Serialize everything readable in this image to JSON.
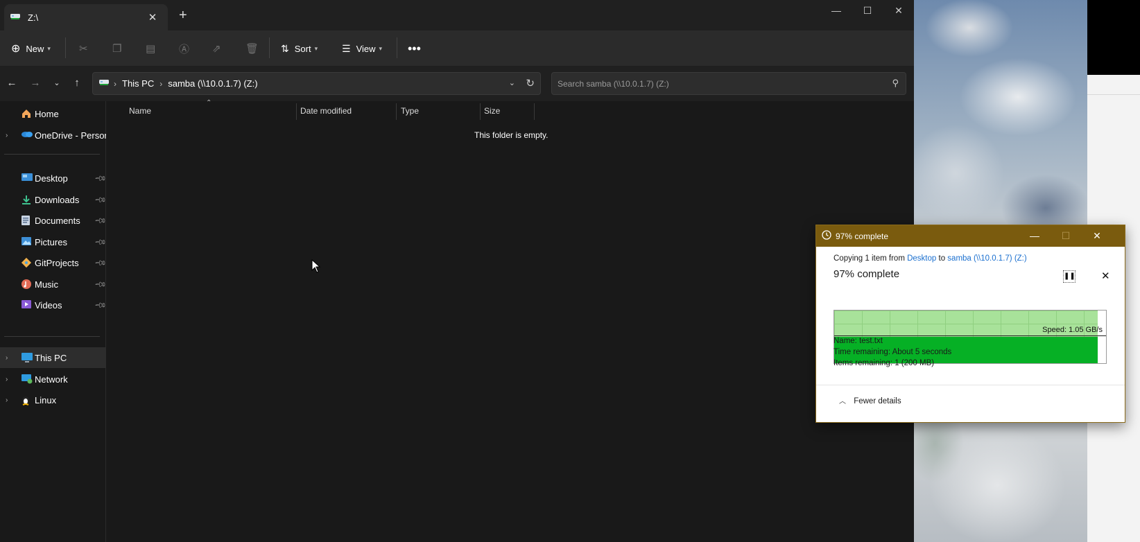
{
  "explorer": {
    "tab_title": "Z:\\",
    "toolbar": {
      "new_label": "New",
      "sort_label": "Sort",
      "view_label": "View"
    },
    "address": {
      "crumbs": [
        "This PC",
        "samba (\\\\10.0.1.7) (Z:)"
      ]
    },
    "search": {
      "placeholder": "Search samba (\\\\10.0.1.7) (Z:)"
    },
    "sidebar": {
      "items": [
        {
          "label": "Home",
          "icon": "home-icon"
        },
        {
          "label": "OneDrive - Persona",
          "icon": "onedrive-icon"
        },
        {
          "label": "Desktop",
          "icon": "desktop-icon",
          "pinned": true
        },
        {
          "label": "Downloads",
          "icon": "downloads-icon",
          "pinned": true
        },
        {
          "label": "Documents",
          "icon": "documents-icon",
          "pinned": true
        },
        {
          "label": "Pictures",
          "icon": "pictures-icon",
          "pinned": true
        },
        {
          "label": "GitProjects",
          "icon": "git-folder-icon",
          "pinned": true
        },
        {
          "label": "Music",
          "icon": "music-icon",
          "pinned": true
        },
        {
          "label": "Videos",
          "icon": "videos-icon",
          "pinned": true
        },
        {
          "label": "This PC",
          "icon": "this-pc-icon",
          "selected": true
        },
        {
          "label": "Network",
          "icon": "network-icon"
        },
        {
          "label": "Linux",
          "icon": "linux-icon"
        }
      ]
    },
    "columns": [
      "Name",
      "Date modified",
      "Type",
      "Size"
    ],
    "empty_message": "This folder is empty."
  },
  "copy_dialog": {
    "title": "97% complete",
    "copy_prefix": "Copying 1 item from",
    "source": "Desktop",
    "to_word": "to",
    "destination": "samba (\\\\10.0.1.7) (Z:)",
    "percent_text": "97% complete",
    "progress_fraction": 0.97,
    "speed": "Speed: 1.05 GB/s",
    "name_label": "Name:",
    "name_value": "test.txt",
    "time_label": "Time remaining:",
    "time_value": "About 5 seconds",
    "items_label": "Items remaining:",
    "items_value": "1 (200 MB)",
    "fewer_details": "Fewer details",
    "title_color": "#7a5b0e",
    "graph_color": "#06b025"
  }
}
